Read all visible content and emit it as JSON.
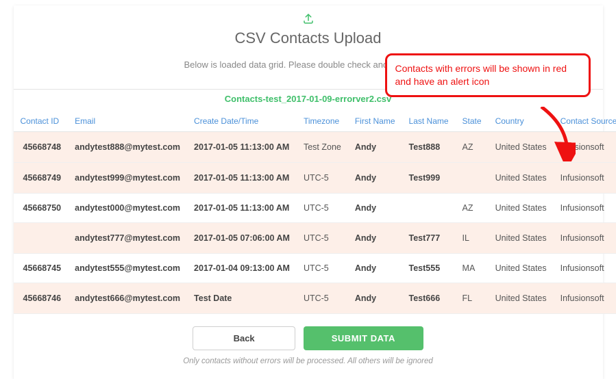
{
  "header": {
    "title": "CSV Contacts Upload",
    "subtitle": "Below is loaded data grid. Please double check and approve it.",
    "filename": "Contacts-test_2017-01-09-errorver2.csv"
  },
  "annotation": {
    "text": "Contacts with errors will be shown in red and have an alert icon"
  },
  "columns": [
    "Contact ID",
    "Email",
    "Create Date/Time",
    "Timezone",
    "First Name",
    "Last Name",
    "State",
    "Country",
    "Contact Source"
  ],
  "rows": [
    {
      "error": true,
      "id": "45668748",
      "email": "andytest888@mytest.com",
      "created": "2017-01-05 11:13:00 AM",
      "tz": "Test Zone",
      "first": "Andy",
      "last": "Test888",
      "state": "AZ",
      "country": "United States",
      "source": "Infusionsoft"
    },
    {
      "error": true,
      "id": "45668749",
      "email": "andytest999@mytest.com",
      "created": "2017-01-05 11:13:00 AM",
      "tz": "UTC-5",
      "first": "Andy",
      "last": "Test999",
      "state": "",
      "country": "United States",
      "source": "Infusionsoft"
    },
    {
      "error": false,
      "id": "45668750",
      "email": "andytest000@mytest.com",
      "created": "2017-01-05 11:13:00 AM",
      "tz": "UTC-5",
      "first": "Andy",
      "last": "",
      "state": "AZ",
      "country": "United States",
      "source": "Infusionsoft"
    },
    {
      "error": true,
      "id": "",
      "email": "andytest777@mytest.com",
      "created": "2017-01-05 07:06:00 AM",
      "tz": "UTC-5",
      "first": "Andy",
      "last": "Test777",
      "state": "IL",
      "country": "United States",
      "source": "Infusionsoft"
    },
    {
      "error": false,
      "id": "45668745",
      "email": "andytest555@mytest.com",
      "created": "2017-01-04 09:13:00 AM",
      "tz": "UTC-5",
      "first": "Andy",
      "last": "Test555",
      "state": "MA",
      "country": "United States",
      "source": "Infusionsoft"
    },
    {
      "error": true,
      "id": "45668746",
      "email": "andytest666@mytest.com",
      "created": "Test Date",
      "tz": "UTC-5",
      "first": "Andy",
      "last": "Test666",
      "state": "FL",
      "country": "United States",
      "source": "Infusionsoft"
    }
  ],
  "buttons": {
    "back": "Back",
    "submit": "SUBMIT DATA"
  },
  "footnote": "Only contacts without errors will be processed. All others will be ignored"
}
